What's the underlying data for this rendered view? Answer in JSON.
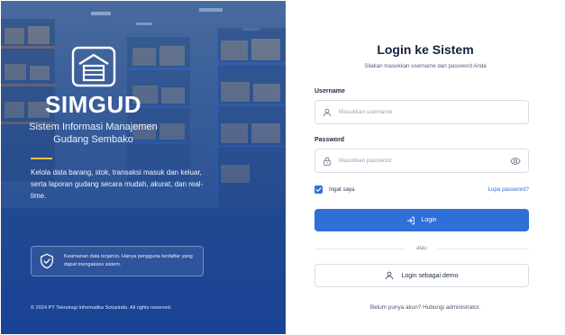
{
  "hero": {
    "brand": "SIMGUD",
    "subtitle_line1": "Sistem Informasi Manajemen",
    "subtitle_line2": "Gudang Sembako",
    "description": "Kelola data barang, stok, transaksi masuk dan keluar, serta laporan gudang secara mudah, akurat, dan real-time.",
    "security_note": "Keamanan data terjamin. Hanya pengguna terdaftar yang dapat mengakses sistem.",
    "copyright": "© 2024 PT Teknologi Informatika Solusindo. All rights reserved.",
    "accent_color": "#f4c142"
  },
  "form": {
    "title": "Login ke Sistem",
    "subtitle": "Silakan masukkan username dan password Anda",
    "username_label": "Username",
    "username_placeholder": "Masukkan username",
    "username_value": "",
    "password_label": "Password",
    "password_placeholder": "Masukkan password",
    "password_value": "",
    "remember_label": "Ingat saya",
    "remember_checked": true,
    "forgot_link": "Lupa password?",
    "login_button": "Login",
    "divider_text": "atau",
    "demo_button": "Login sebagai demo",
    "footer_note": "Belum punya akun? Hubungi administrator.",
    "primary_color": "#2f6fd8"
  }
}
